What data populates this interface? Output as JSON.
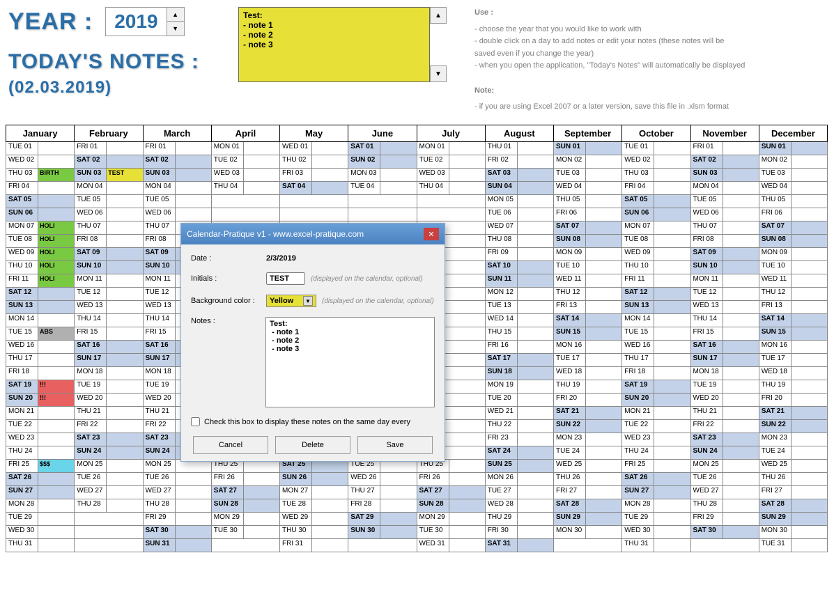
{
  "header": {
    "year_label": "YEAR :",
    "year_value": "2019",
    "today_label": "TODAY'S NOTES :",
    "today_date": "(02.03.2019)",
    "notes_box": "Test:\n - note 1\n - note 2\n - note 3"
  },
  "help": {
    "use_title": "Use :",
    "use_lines": [
      "- choose the year that you would like to work with",
      "- double click on a day to add notes or edit your notes (these notes will be",
      "   saved even if you change the year)",
      "- when you open the application, \"Today's Notes\" will automatically be displayed"
    ],
    "note_title": "Note:",
    "note_line": "- if you are using Excel 2007 or a later version, save this file in .xlsm format"
  },
  "months": [
    "January",
    "February",
    "March",
    "April",
    "May",
    "June",
    "July",
    "August",
    "September",
    "October",
    "November",
    "December"
  ],
  "calendar": [
    [
      {
        "d": "TUE 01"
      },
      {
        "d": "FRI 01"
      },
      {
        "d": "FRI 01"
      },
      {
        "d": "MON 01"
      },
      {
        "d": "WED 01"
      },
      {
        "d": "SAT 01",
        "w": 1
      },
      {
        "d": "MON 01"
      },
      {
        "d": "THU 01"
      },
      {
        "d": "SUN 01",
        "w": 1
      },
      {
        "d": "TUE 01"
      },
      {
        "d": "FRI 01"
      },
      {
        "d": "SUN 01",
        "w": 1
      }
    ],
    [
      {
        "d": "WED 02"
      },
      {
        "d": "SAT 02",
        "w": 1
      },
      {
        "d": "SAT 02",
        "w": 1
      },
      {
        "d": "TUE 02"
      },
      {
        "d": "THU 02"
      },
      {
        "d": "SUN 02",
        "w": 1
      },
      {
        "d": "TUE 02"
      },
      {
        "d": "FRI 02"
      },
      {
        "d": "MON 02"
      },
      {
        "d": "WED 02"
      },
      {
        "d": "SAT 02",
        "w": 1
      },
      {
        "d": "MON 02"
      }
    ],
    [
      {
        "d": "THU 03",
        "n": "BIRTH",
        "c": "green"
      },
      {
        "d": "SUN 03",
        "w": 1,
        "n": "TEST",
        "c": "yellow"
      },
      {
        "d": "SUN 03",
        "w": 1
      },
      {
        "d": "WED 03"
      },
      {
        "d": "FRI 03"
      },
      {
        "d": "MON 03"
      },
      {
        "d": "WED 03"
      },
      {
        "d": "SAT 03",
        "w": 1
      },
      {
        "d": "TUE 03"
      },
      {
        "d": "THU 03"
      },
      {
        "d": "SUN 03",
        "w": 1
      },
      {
        "d": "TUE 03"
      }
    ],
    [
      {
        "d": "FRI 04"
      },
      {
        "d": "MON 04"
      },
      {
        "d": "MON 04"
      },
      {
        "d": "THU 04"
      },
      {
        "d": "SAT 04",
        "w": 1
      },
      {
        "d": "TUE 04"
      },
      {
        "d": "THU 04"
      },
      {
        "d": "SUN 04",
        "w": 1
      },
      {
        "d": "WED 04"
      },
      {
        "d": "FRI 04"
      },
      {
        "d": "MON 04"
      },
      {
        "d": "WED 04"
      }
    ],
    [
      {
        "d": "SAT 05",
        "w": 1
      },
      {
        "d": "TUE 05"
      },
      {
        "d": "TUE 05"
      },
      {
        "d": ""
      },
      {
        "d": ""
      },
      {
        "d": ""
      },
      {
        "d": ""
      },
      {
        "d": "MON 05"
      },
      {
        "d": "THU 05"
      },
      {
        "d": "SAT 05",
        "w": 1
      },
      {
        "d": "TUE 05"
      },
      {
        "d": "THU 05"
      }
    ],
    [
      {
        "d": "SUN 06",
        "w": 1
      },
      {
        "d": "WED 06"
      },
      {
        "d": "WED 06"
      },
      {
        "d": ""
      },
      {
        "d": ""
      },
      {
        "d": ""
      },
      {
        "d": ""
      },
      {
        "d": "TUE 06"
      },
      {
        "d": "FRI 06"
      },
      {
        "d": "SUN 06",
        "w": 1
      },
      {
        "d": "WED 06"
      },
      {
        "d": "FRI 06"
      }
    ],
    [
      {
        "d": "MON 07",
        "n": "HOLI",
        "c": "green"
      },
      {
        "d": "THU 07"
      },
      {
        "d": "THU 07"
      },
      {
        "d": ""
      },
      {
        "d": ""
      },
      {
        "d": ""
      },
      {
        "d": ""
      },
      {
        "d": "WED 07"
      },
      {
        "d": "SAT 07",
        "w": 1
      },
      {
        "d": "MON 07"
      },
      {
        "d": "THU 07"
      },
      {
        "d": "SAT 07",
        "w": 1
      }
    ],
    [
      {
        "d": "TUE 08",
        "n": "HOLI",
        "c": "green"
      },
      {
        "d": "FRI 08"
      },
      {
        "d": "FRI 08"
      },
      {
        "d": ""
      },
      {
        "d": ""
      },
      {
        "d": ""
      },
      {
        "d": ""
      },
      {
        "d": "THU 08"
      },
      {
        "d": "SUN 08",
        "w": 1
      },
      {
        "d": "TUE 08"
      },
      {
        "d": "FRI 08"
      },
      {
        "d": "SUN 08",
        "w": 1
      }
    ],
    [
      {
        "d": "WED 09",
        "n": "HOLI",
        "c": "green"
      },
      {
        "d": "SAT 09",
        "w": 1
      },
      {
        "d": "SAT 09",
        "w": 1
      },
      {
        "d": ""
      },
      {
        "d": ""
      },
      {
        "d": ""
      },
      {
        "d": ""
      },
      {
        "d": "FRI 09"
      },
      {
        "d": "MON 09"
      },
      {
        "d": "WED 09"
      },
      {
        "d": "SAT 09",
        "w": 1
      },
      {
        "d": "MON 09"
      }
    ],
    [
      {
        "d": "THU 10",
        "n": "HOLI",
        "c": "green"
      },
      {
        "d": "SUN 10",
        "w": 1
      },
      {
        "d": "SUN 10",
        "w": 1
      },
      {
        "d": ""
      },
      {
        "d": ""
      },
      {
        "d": ""
      },
      {
        "d": ""
      },
      {
        "d": "SAT 10",
        "w": 1
      },
      {
        "d": "TUE 10"
      },
      {
        "d": "THU 10"
      },
      {
        "d": "SUN 10",
        "w": 1
      },
      {
        "d": "TUE 10"
      }
    ],
    [
      {
        "d": "FRI 11",
        "n": "HOLI",
        "c": "green"
      },
      {
        "d": "MON 11"
      },
      {
        "d": "MON 11"
      },
      {
        "d": ""
      },
      {
        "d": ""
      },
      {
        "d": ""
      },
      {
        "d": ""
      },
      {
        "d": "SUN 11",
        "w": 1
      },
      {
        "d": "WED 11"
      },
      {
        "d": "FRI 11"
      },
      {
        "d": "MON 11"
      },
      {
        "d": "WED 11"
      }
    ],
    [
      {
        "d": "SAT 12",
        "w": 1
      },
      {
        "d": "TUE 12"
      },
      {
        "d": "TUE 12"
      },
      {
        "d": ""
      },
      {
        "d": ""
      },
      {
        "d": ""
      },
      {
        "d": ""
      },
      {
        "d": "MON 12"
      },
      {
        "d": "THU 12"
      },
      {
        "d": "SAT 12",
        "w": 1
      },
      {
        "d": "TUE 12"
      },
      {
        "d": "THU 12"
      }
    ],
    [
      {
        "d": "SUN 13",
        "w": 1
      },
      {
        "d": "WED 13"
      },
      {
        "d": "WED 13"
      },
      {
        "d": ""
      },
      {
        "d": ""
      },
      {
        "d": ""
      },
      {
        "d": ""
      },
      {
        "d": "TUE 13"
      },
      {
        "d": "FRI 13"
      },
      {
        "d": "SUN 13",
        "w": 1
      },
      {
        "d": "WED 13"
      },
      {
        "d": "FRI 13"
      }
    ],
    [
      {
        "d": "MON 14"
      },
      {
        "d": "THU 14"
      },
      {
        "d": "THU 14"
      },
      {
        "d": ""
      },
      {
        "d": ""
      },
      {
        "d": ""
      },
      {
        "d": ""
      },
      {
        "d": "WED 14"
      },
      {
        "d": "SAT 14",
        "w": 1
      },
      {
        "d": "MON 14"
      },
      {
        "d": "THU 14"
      },
      {
        "d": "SAT 14",
        "w": 1
      }
    ],
    [
      {
        "d": "TUE 15",
        "n": "ABS",
        "c": "gray"
      },
      {
        "d": "FRI 15"
      },
      {
        "d": "FRI 15"
      },
      {
        "d": ""
      },
      {
        "d": ""
      },
      {
        "d": ""
      },
      {
        "d": ""
      },
      {
        "d": "THU 15"
      },
      {
        "d": "SUN 15",
        "w": 1
      },
      {
        "d": "TUE 15"
      },
      {
        "d": "FRI 15"
      },
      {
        "d": "SUN 15",
        "w": 1
      }
    ],
    [
      {
        "d": "WED 16"
      },
      {
        "d": "SAT 16",
        "w": 1
      },
      {
        "d": "SAT 16",
        "w": 1
      },
      {
        "d": ""
      },
      {
        "d": ""
      },
      {
        "d": ""
      },
      {
        "d": ""
      },
      {
        "d": "FRI 16"
      },
      {
        "d": "MON 16"
      },
      {
        "d": "WED 16"
      },
      {
        "d": "SAT 16",
        "w": 1
      },
      {
        "d": "MON 16"
      }
    ],
    [
      {
        "d": "THU 17"
      },
      {
        "d": "SUN 17",
        "w": 1
      },
      {
        "d": "SUN 17",
        "w": 1
      },
      {
        "d": ""
      },
      {
        "d": ""
      },
      {
        "d": ""
      },
      {
        "d": ""
      },
      {
        "d": "SAT 17",
        "w": 1
      },
      {
        "d": "TUE 17"
      },
      {
        "d": "THU 17"
      },
      {
        "d": "SUN 17",
        "w": 1
      },
      {
        "d": "TUE 17"
      }
    ],
    [
      {
        "d": "FRI 18"
      },
      {
        "d": "MON 18"
      },
      {
        "d": "MON 18"
      },
      {
        "d": ""
      },
      {
        "d": ""
      },
      {
        "d": ""
      },
      {
        "d": ""
      },
      {
        "d": "SUN 18",
        "w": 1
      },
      {
        "d": "WED 18"
      },
      {
        "d": "FRI 18"
      },
      {
        "d": "MON 18"
      },
      {
        "d": "WED 18"
      }
    ],
    [
      {
        "d": "SAT 19",
        "w": 1,
        "n": "!!!",
        "c": "red"
      },
      {
        "d": "TUE 19"
      },
      {
        "d": "TUE 19"
      },
      {
        "d": ""
      },
      {
        "d": ""
      },
      {
        "d": ""
      },
      {
        "d": ""
      },
      {
        "d": "MON 19"
      },
      {
        "d": "THU 19"
      },
      {
        "d": "SAT 19",
        "w": 1
      },
      {
        "d": "TUE 19"
      },
      {
        "d": "THU 19"
      }
    ],
    [
      {
        "d": "SUN 20",
        "w": 1,
        "n": "!!!",
        "c": "red"
      },
      {
        "d": "WED 20"
      },
      {
        "d": "WED 20"
      },
      {
        "d": ""
      },
      {
        "d": ""
      },
      {
        "d": ""
      },
      {
        "d": ""
      },
      {
        "d": "TUE 20"
      },
      {
        "d": "FRI 20"
      },
      {
        "d": "SUN 20",
        "w": 1
      },
      {
        "d": "WED 20"
      },
      {
        "d": "FRI 20"
      }
    ],
    [
      {
        "d": "MON 21"
      },
      {
        "d": "THU 21"
      },
      {
        "d": "THU 21"
      },
      {
        "d": ""
      },
      {
        "d": ""
      },
      {
        "d": ""
      },
      {
        "d": ""
      },
      {
        "d": "WED 21"
      },
      {
        "d": "SAT 21",
        "w": 1
      },
      {
        "d": "MON 21"
      },
      {
        "d": "THU 21"
      },
      {
        "d": "SAT 21",
        "w": 1
      }
    ],
    [
      {
        "d": "TUE 22"
      },
      {
        "d": "FRI 22"
      },
      {
        "d": "FRI 22"
      },
      {
        "d": ""
      },
      {
        "d": ""
      },
      {
        "d": ""
      },
      {
        "d": ""
      },
      {
        "d": "THU 22"
      },
      {
        "d": "SUN 22",
        "w": 1
      },
      {
        "d": "TUE 22"
      },
      {
        "d": "FRI 22"
      },
      {
        "d": "SUN 22",
        "w": 1
      }
    ],
    [
      {
        "d": "WED 23"
      },
      {
        "d": "SAT 23",
        "w": 1
      },
      {
        "d": "SAT 23",
        "w": 1
      },
      {
        "d": ""
      },
      {
        "d": ""
      },
      {
        "d": ""
      },
      {
        "d": ""
      },
      {
        "d": "FRI 23"
      },
      {
        "d": "MON 23"
      },
      {
        "d": "WED 23"
      },
      {
        "d": "SAT 23",
        "w": 1
      },
      {
        "d": "MON 23"
      }
    ],
    [
      {
        "d": "THU 24"
      },
      {
        "d": "SUN 24",
        "w": 1
      },
      {
        "d": "SUN 24",
        "w": 1
      },
      {
        "d": ""
      },
      {
        "d": ""
      },
      {
        "d": ""
      },
      {
        "d": ""
      },
      {
        "d": "SAT 24",
        "w": 1
      },
      {
        "d": "TUE 24"
      },
      {
        "d": "THU 24"
      },
      {
        "d": "SUN 24",
        "w": 1
      },
      {
        "d": "TUE 24"
      }
    ],
    [
      {
        "d": "FRI 25",
        "n": "$$$",
        "c": "cyan"
      },
      {
        "d": "MON 25"
      },
      {
        "d": "MON 25"
      },
      {
        "d": "THU 25"
      },
      {
        "d": "SAT 25",
        "w": 1
      },
      {
        "d": "TUE 25"
      },
      {
        "d": "THU 25"
      },
      {
        "d": "SUN 25",
        "w": 1
      },
      {
        "d": "WED 25"
      },
      {
        "d": "FRI 25"
      },
      {
        "d": "MON 25"
      },
      {
        "d": "WED 25"
      }
    ],
    [
      {
        "d": "SAT 26",
        "w": 1
      },
      {
        "d": "TUE 26"
      },
      {
        "d": "TUE 26"
      },
      {
        "d": "FRI 26"
      },
      {
        "d": "SUN 26",
        "w": 1
      },
      {
        "d": "WED 26"
      },
      {
        "d": "FRI 26"
      },
      {
        "d": "MON 26"
      },
      {
        "d": "THU 26"
      },
      {
        "d": "SAT 26",
        "w": 1
      },
      {
        "d": "TUE 26"
      },
      {
        "d": "THU 26"
      }
    ],
    [
      {
        "d": "SUN 27",
        "w": 1
      },
      {
        "d": "WED 27"
      },
      {
        "d": "WED 27"
      },
      {
        "d": "SAT 27",
        "w": 1
      },
      {
        "d": "MON 27"
      },
      {
        "d": "THU 27"
      },
      {
        "d": "SAT 27",
        "w": 1
      },
      {
        "d": "TUE 27"
      },
      {
        "d": "FRI 27"
      },
      {
        "d": "SUN 27",
        "w": 1
      },
      {
        "d": "WED 27"
      },
      {
        "d": "FRI 27"
      }
    ],
    [
      {
        "d": "MON 28"
      },
      {
        "d": "THU 28"
      },
      {
        "d": "THU 28"
      },
      {
        "d": "SUN 28",
        "w": 1
      },
      {
        "d": "TUE 28"
      },
      {
        "d": "FRI 28"
      },
      {
        "d": "SUN 28",
        "w": 1
      },
      {
        "d": "WED 28"
      },
      {
        "d": "SAT 28",
        "w": 1
      },
      {
        "d": "MON 28"
      },
      {
        "d": "THU 28"
      },
      {
        "d": "SAT 28",
        "w": 1
      }
    ],
    [
      {
        "d": "TUE 29"
      },
      {
        "d": ""
      },
      {
        "d": "FRI 29"
      },
      {
        "d": "MON 29"
      },
      {
        "d": "WED 29"
      },
      {
        "d": "SAT 29",
        "w": 1
      },
      {
        "d": "MON 29"
      },
      {
        "d": "THU 29"
      },
      {
        "d": "SUN 29",
        "w": 1
      },
      {
        "d": "TUE 29"
      },
      {
        "d": "FRI 29"
      },
      {
        "d": "SUN 29",
        "w": 1
      }
    ],
    [
      {
        "d": "WED 30"
      },
      {
        "d": ""
      },
      {
        "d": "SAT 30",
        "w": 1
      },
      {
        "d": "TUE 30"
      },
      {
        "d": "THU 30"
      },
      {
        "d": "SUN 30",
        "w": 1
      },
      {
        "d": "TUE 30"
      },
      {
        "d": "FRI 30"
      },
      {
        "d": "MON 30"
      },
      {
        "d": "WED 30"
      },
      {
        "d": "SAT 30",
        "w": 1
      },
      {
        "d": "MON 30"
      }
    ],
    [
      {
        "d": "THU 31"
      },
      {
        "d": ""
      },
      {
        "d": "SUN 31",
        "w": 1
      },
      {
        "d": ""
      },
      {
        "d": "FRI 31"
      },
      {
        "d": ""
      },
      {
        "d": "WED 31"
      },
      {
        "d": "SAT 31",
        "w": 1
      },
      {
        "d": ""
      },
      {
        "d": "THU 31"
      },
      {
        "d": ""
      },
      {
        "d": "TUE 31"
      }
    ]
  ],
  "dialog": {
    "title": "Calendar-Pratique v1 - www.excel-pratique.com",
    "date_label": "Date :",
    "date_value": "2/3/2019",
    "initials_label": "Initials :",
    "initials_value": "TEST",
    "initials_hint": "(displayed on the calendar, optional)",
    "bg_label": "Background color :",
    "bg_value": "Yellow",
    "bg_hint": "(displayed on the calendar, optional)",
    "notes_label": "Notes :",
    "notes_value": "Test:\n - note 1\n - note 2\n - note 3",
    "check_label": "Check this box to display these notes on the same day every",
    "btn_cancel": "Cancel",
    "btn_delete": "Delete",
    "btn_save": "Save"
  }
}
